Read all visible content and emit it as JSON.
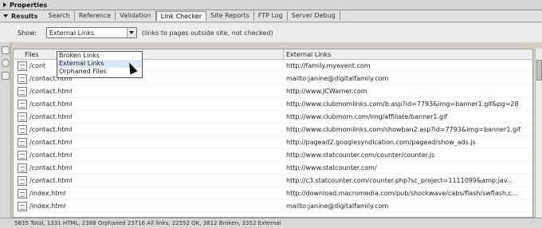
{
  "panel": {
    "properties_label": "Properties",
    "results_label": "Results",
    "tabs": [
      {
        "label": "Search"
      },
      {
        "label": "Reference"
      },
      {
        "label": "Validation"
      },
      {
        "label": "Link Checker",
        "active": true
      },
      {
        "label": "Site Reports"
      },
      {
        "label": "FTP Log"
      },
      {
        "label": "Server Debug"
      }
    ]
  },
  "filter": {
    "show_label": "Show:",
    "selected": "External Links",
    "note": "(links to pages outside site, not checked)",
    "options": [
      "Broken Links",
      "External Links",
      "Orphaned Files"
    ],
    "hovered_option": "External Links"
  },
  "table": {
    "columns": [
      "Files",
      "External Links"
    ],
    "rows": [
      {
        "file": "/cont",
        "external": "http://family.myevent.com"
      },
      {
        "file": "/contact.html",
        "external": "mailto:janine@digitalfamily.com"
      },
      {
        "file": "/contact.html",
        "external": "http://www.JCWarner.com"
      },
      {
        "file": "/contact.html",
        "external": "http://www.clubmomlinks.com/b.asp?id=7793&img=banner1.gif&pg=28"
      },
      {
        "file": "/contact.html",
        "external": "http://www.clubmom.com/img/affiliate/banner1.gif"
      },
      {
        "file": "/contact.html",
        "external": "http://www.clubmomlinks.com/showban2.asp?id=7793&img=banner1.gif"
      },
      {
        "file": "/contact.html",
        "external": "http://pagead2.googlesyndication.com/pagead/show_ads.js"
      },
      {
        "file": "/contact.html",
        "external": "http://www.statcounter.com/counter/counter.js"
      },
      {
        "file": "/contact.html",
        "external": "http://www.statcounter.com/"
      },
      {
        "file": "/contact.html",
        "external": "http://c3.statcounter.com/counter.php?sc_project=1111099&amp;jav..."
      },
      {
        "file": "/index.html",
        "external": "http://download.macromedia.com/pub/shockwave/cabs/flash/swflash.c..."
      },
      {
        "file": "/index.html",
        "external": "mailto:janine@digitalfamily.com"
      }
    ]
  },
  "status": "5635 Total, 1331 HTML, 2388 Orphaned 23716 All links, 22552 OK, 3812 Broken, 3352 External"
}
